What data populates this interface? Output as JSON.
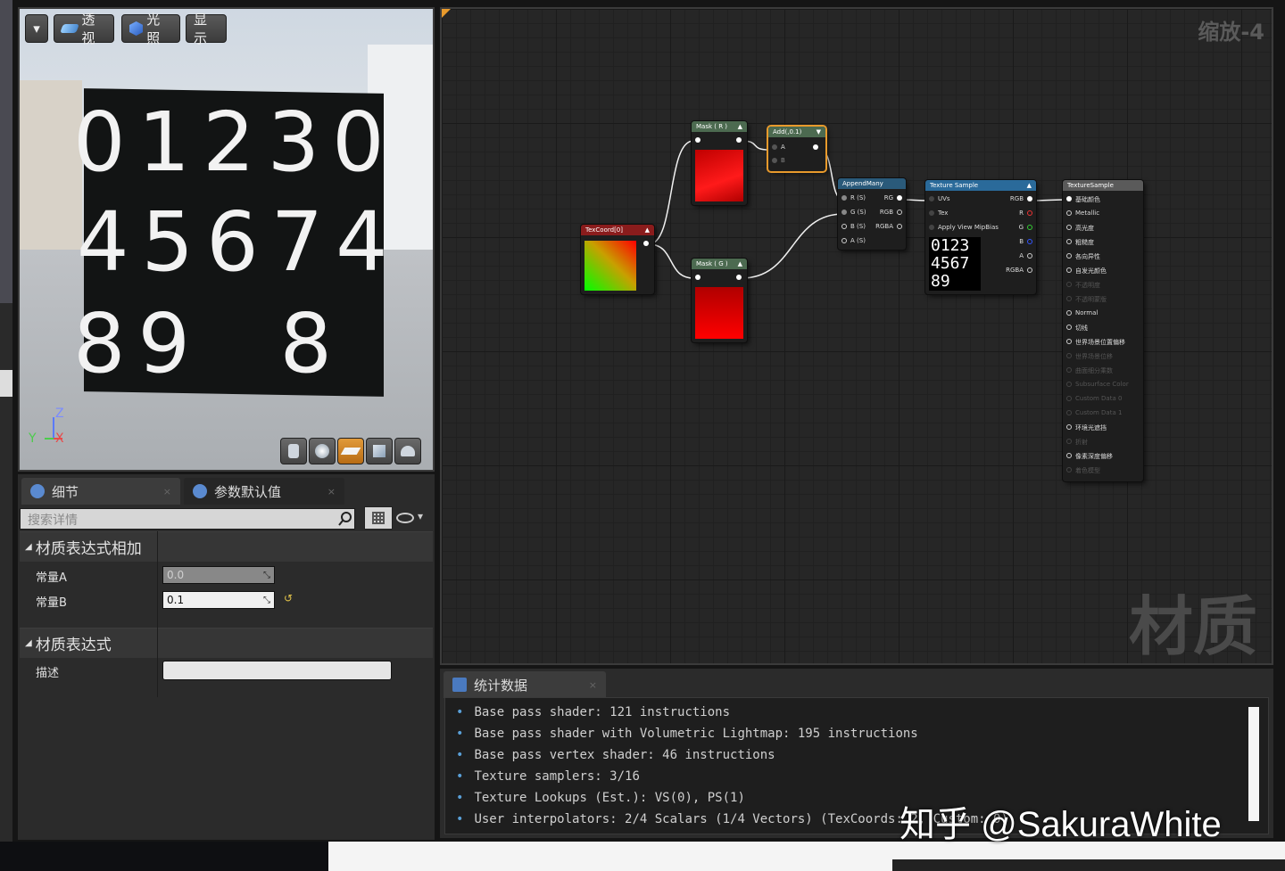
{
  "viewport": {
    "menu_arrow": "▾",
    "btn_perspective": "透视",
    "btn_lit": "光照",
    "btn_show": "显示",
    "digits_row1": "01230",
    "digits_row2": "45674",
    "digits_row3": "89  8",
    "axis_z": "Z",
    "axis_y": "Y",
    "axis_x": "X"
  },
  "details": {
    "tab_details": "细节",
    "tab_defaults": "参数默认值",
    "search_placeholder": "搜索详情",
    "section_add": "材质表达式相加",
    "const_a_label": "常量A",
    "const_a_value": "0.0",
    "const_b_label": "常量B",
    "const_b_value": "0.1",
    "section_expr": "材质表达式",
    "desc_label": "描述",
    "desc_value": ""
  },
  "graph": {
    "zoom_label": "缩放-4",
    "watermark": "材质",
    "nodes": {
      "texcoord": "TexCoord[0]",
      "mask_r": "Mask ( R )",
      "mask_g": "Mask ( G )",
      "add": "Add(,0.1)",
      "add_a": "A",
      "add_b": "B",
      "append": "AppendMany",
      "append_pins": [
        "R (S)",
        "G (S)",
        "B (S)",
        "A (S)"
      ],
      "append_outs": [
        "RG",
        "RGB",
        "RGBA"
      ],
      "texsample": "Texture Sample",
      "tex_pins": [
        "UVs",
        "Tex",
        "Apply View MipBias"
      ],
      "tex_outs": [
        "RGB",
        "R",
        "G",
        "B",
        "A",
        "RGBA"
      ],
      "tex_digits": "0123\n4567\n89",
      "result": "TextureSample",
      "result_pins": [
        "基础颜色",
        "Metallic",
        "高光度",
        "粗糙度",
        "各向异性",
        "自发光颜色",
        "不透明度",
        "不透明蒙版",
        "Normal",
        "切线",
        "世界场景位置偏移",
        "世界场景位移",
        "曲面细分乘数",
        "Subsurface Color",
        "Custom Data 0",
        "Custom Data 1",
        "环境光遮挡",
        "折射",
        "像素深度偏移",
        "着色模型"
      ],
      "result_active": [
        true,
        true,
        true,
        true,
        true,
        true,
        false,
        false,
        true,
        true,
        true,
        false,
        false,
        false,
        false,
        false,
        true,
        false,
        true,
        false
      ]
    }
  },
  "stats": {
    "tab_label": "统计数据",
    "lines": [
      "Base pass shader: 121 instructions",
      "Base pass shader with Volumetric Lightmap: 195 instructions",
      "Base pass vertex shader: 46 instructions",
      "Texture samplers: 3/16",
      "Texture Lookups (Est.): VS(0), PS(1)",
      "User interpolators: 2/4 Scalars (1/4 Vectors) (TexCoords: 2, Custom: 0)"
    ]
  },
  "overlay_watermark": "知乎 @SakuraWhite",
  "colors": {
    "accent": "#e89a2c",
    "blue_header": "#2a6a9a",
    "red_header": "#8a1c1c",
    "green_header": "#4c6a50"
  }
}
